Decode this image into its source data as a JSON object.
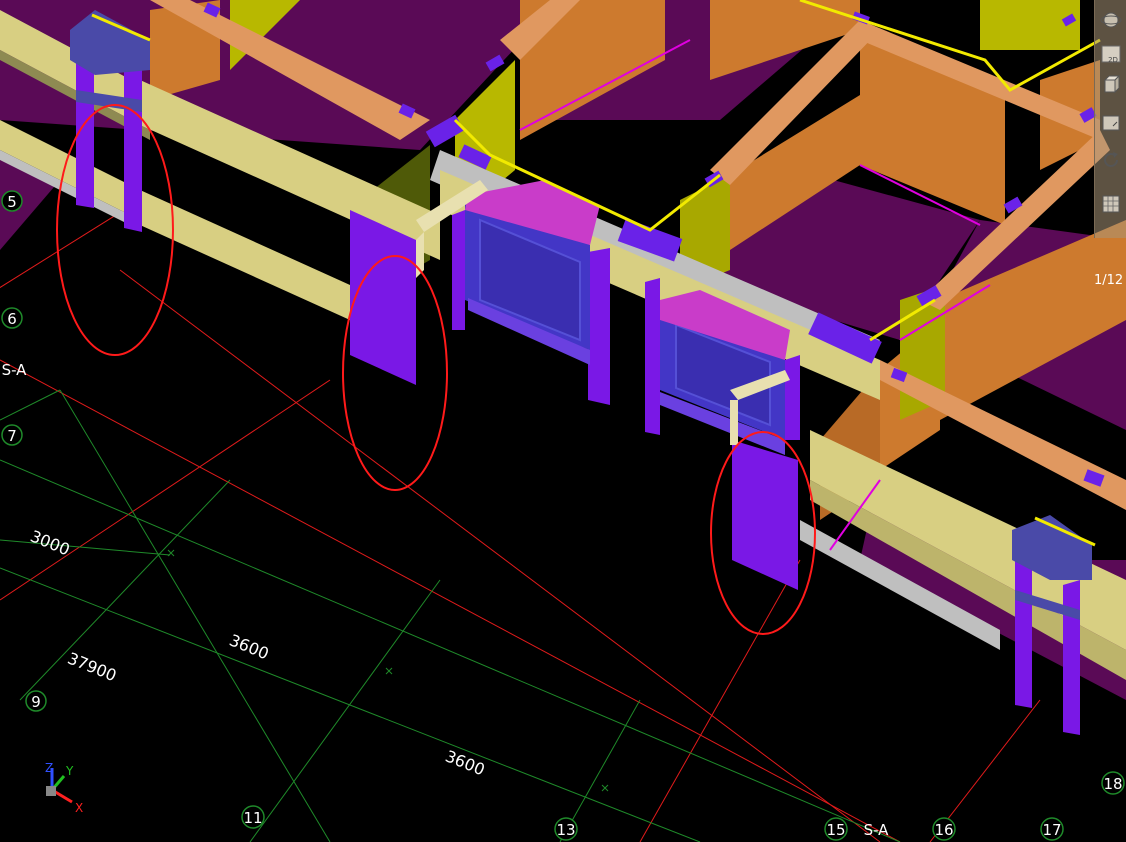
{
  "viewport": {
    "grid_labels": {
      "circled": {
        "row_5": "5",
        "row_6": "6",
        "row_7": "7",
        "row_9": "9",
        "col_11": "11",
        "col_13": "13",
        "col_15": "15",
        "col_16": "16",
        "col_17": "17",
        "col_18": "18"
      },
      "plain": {
        "axis_left": "S-A",
        "axis_bottom": "S-A"
      }
    },
    "dimensions": {
      "d1": "3000",
      "d2": "37900",
      "d3": "3600",
      "d4": "3600"
    },
    "axes": {
      "z": "Z",
      "y": "Y",
      "x": "X"
    },
    "partial_right_label": "1/12"
  },
  "toolbar": {
    "buttons": [
      {
        "name": "orbit-button",
        "icon": "orbit-icon"
      },
      {
        "name": "view-2d-button",
        "icon": "2d-icon",
        "label": "2D"
      },
      {
        "name": "view-3d-button",
        "icon": "cube-icon"
      },
      {
        "name": "view-plane-button",
        "icon": "plane-icon"
      },
      {
        "name": "rotate-button",
        "icon": "rotate-icon"
      },
      {
        "name": "section-button",
        "icon": "grid-icon"
      }
    ]
  },
  "colors": {
    "background": "#000000",
    "grid_red": "#e01b1b",
    "grid_green": "#1f8a2a",
    "wall_purple": "#5a0a56",
    "wall_orange": "#cd7a2e",
    "beam_beige": "#d8cf82",
    "column_violet": "#7a18e6",
    "slab_magenta": "#c93cc9",
    "highlight_circle": "#ff1a1a"
  }
}
